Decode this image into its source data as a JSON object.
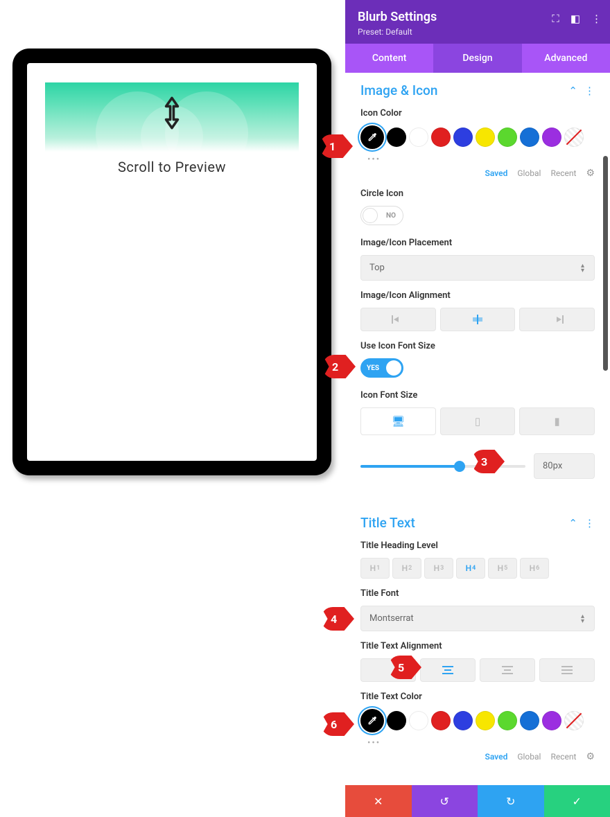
{
  "header": {
    "title": "Blurb Settings",
    "preset": "Preset: Default"
  },
  "tabs": {
    "content": "Content",
    "design": "Design",
    "advanced": "Advanced"
  },
  "preview": {
    "scroll_text": "Scroll to Preview"
  },
  "sections": {
    "image_icon": {
      "title": "Image & Icon"
    },
    "title_text": {
      "title": "Title Text"
    }
  },
  "labels": {
    "icon_color": "Icon Color",
    "circle_icon": "Circle Icon",
    "placement": "Image/Icon Placement",
    "alignment": "Image/Icon Alignment",
    "use_icon_font_size": "Use Icon Font Size",
    "icon_font_size": "Icon Font Size",
    "title_heading_level": "Title Heading Level",
    "title_font": "Title Font",
    "title_text_alignment": "Title Text Alignment",
    "title_text_color": "Title Text Color"
  },
  "values": {
    "circle_icon_no": "NO",
    "use_icon_yes": "YES",
    "placement": "Top",
    "icon_font_size": "80px",
    "title_font": "Montserrat",
    "slider_pct": 60
  },
  "color_tabs": {
    "saved": "Saved",
    "global": "Global",
    "recent": "Recent"
  },
  "headings": [
    "H1",
    "H2",
    "H3",
    "H4",
    "H5",
    "H6"
  ],
  "heading_active": 3,
  "swatches": [
    "#000000",
    "#ffffff",
    "#e02020",
    "#2d3ee0",
    "#f7e600",
    "#5bd82e",
    "#156fd6",
    "#9b2ee0"
  ],
  "markers": [
    "1",
    "2",
    "3",
    "4",
    "5",
    "6"
  ]
}
